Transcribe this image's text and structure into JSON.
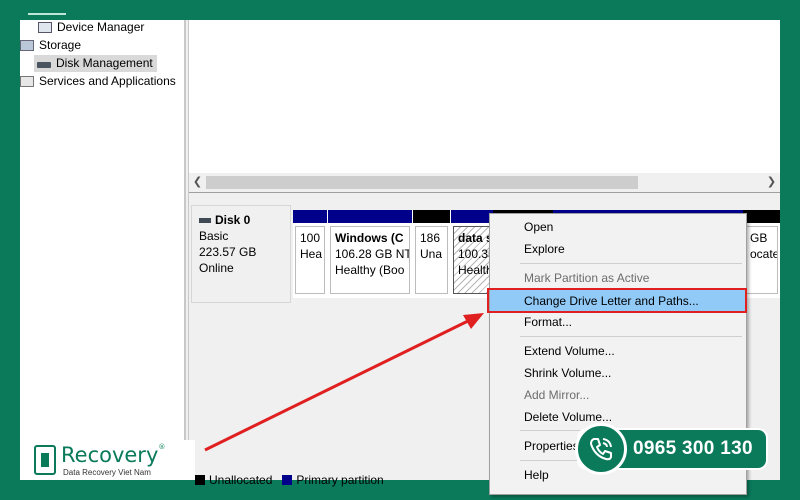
{
  "tree": {
    "items": [
      {
        "label": "Device Manager",
        "icon": "device-manager-icon"
      },
      {
        "label": "Storage",
        "icon": "storage-icon"
      },
      {
        "label": "Disk Management",
        "icon": "disk-management-icon",
        "selected": true
      },
      {
        "label": "Services and Applications",
        "icon": "services-icon"
      }
    ]
  },
  "disk": {
    "name": "Disk 0",
    "type": "Basic",
    "size": "223.57 GB",
    "status": "Online",
    "partitions": [
      {
        "line1": "100",
        "line2": "Hea",
        "cap_color": "#00008b"
      },
      {
        "line1": "Windows  (C",
        "line2": "106.28 GB NT",
        "line3": "Healthy (Boo",
        "cap_color": "#00008b"
      },
      {
        "line1": "186",
        "line2": "Una",
        "cap_color": "#000000"
      },
      {
        "line1": "data s",
        "line2": "100.35",
        "line3": "Health",
        "cap_color": "#00008b",
        "selected": true
      },
      {
        "line1": "GB",
        "line2": "ocate",
        "cap_color": "#000000"
      }
    ]
  },
  "legend": [
    {
      "label": "Unallocated",
      "color": "#000000"
    },
    {
      "label": "Primary partition",
      "color": "#00008b"
    }
  ],
  "context_menu": {
    "items": [
      {
        "label": "Open",
        "disabled": false
      },
      {
        "label": "Explore",
        "disabled": false
      },
      {
        "label": "Mark Partition as Active",
        "disabled": true
      },
      {
        "label": "Change Drive Letter and Paths...",
        "disabled": false,
        "highlighted": true
      },
      {
        "label": "Format...",
        "disabled": false
      },
      {
        "label": "Extend Volume...",
        "disabled": false
      },
      {
        "label": "Shrink Volume...",
        "disabled": false
      },
      {
        "label": "Add Mirror...",
        "disabled": true
      },
      {
        "label": "Delete Volume...",
        "disabled": false
      },
      {
        "label": "Properties",
        "disabled": false
      },
      {
        "label": "Help",
        "disabled": false
      }
    ]
  },
  "branding": {
    "logo_name": "Recovery",
    "logo_reg": "®",
    "logo_tagline": "Data Recovery Viet Nam",
    "phone": "0965 300 130"
  },
  "annotation_color": "#e02020",
  "highlight_color": "#91c9f7"
}
